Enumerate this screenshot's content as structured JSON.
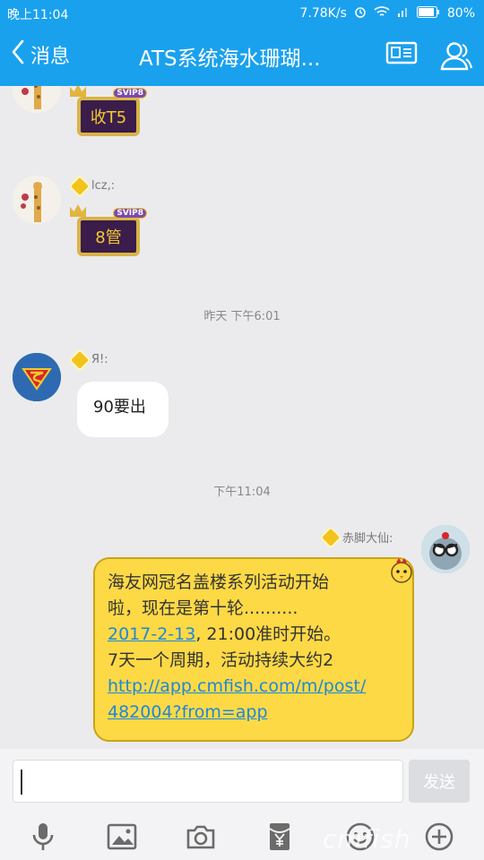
{
  "status_bar": {
    "time": "晚上11:04",
    "network_speed": "7.78K/s",
    "battery": "80%"
  },
  "header": {
    "back_label": "消息",
    "title": "ATS系统海水珊瑚..."
  },
  "messages": [
    {
      "sender": "",
      "badge_text": "收T5",
      "badge_tag": "SVIP8"
    },
    {
      "sender": "lcz,:",
      "badge_text": "8管",
      "badge_tag": "SVIP8"
    },
    {
      "timestamp": "昨天 下午6:01"
    },
    {
      "sender": "Я!:",
      "text": "90要出"
    },
    {
      "timestamp": "下午11:04"
    },
    {
      "sender": "赤脚大仙:",
      "line1": "海友网冠名盖楼系列活动开始",
      "line2": "啦，现在是第十轮..........",
      "line3_link": "2017-2-13",
      "line3_rest": ", 21:00准时开始。",
      "line4": "7天一个周期，活动持续大约2",
      "url_line1": "http://app.cmfish.com/m/post/",
      "url_line2": "482004?from=app"
    }
  ],
  "input": {
    "send_label": "发送",
    "value": ""
  },
  "toolbar_icons": [
    "microphone-icon",
    "image-icon",
    "camera-icon",
    "red-packet-icon",
    "emoji-icon",
    "plus-icon"
  ],
  "colors": {
    "accent": "#1aa1ee",
    "bubble_yellow": "#fdd946",
    "link": "#1e88d8"
  },
  "watermark": "cmfish"
}
